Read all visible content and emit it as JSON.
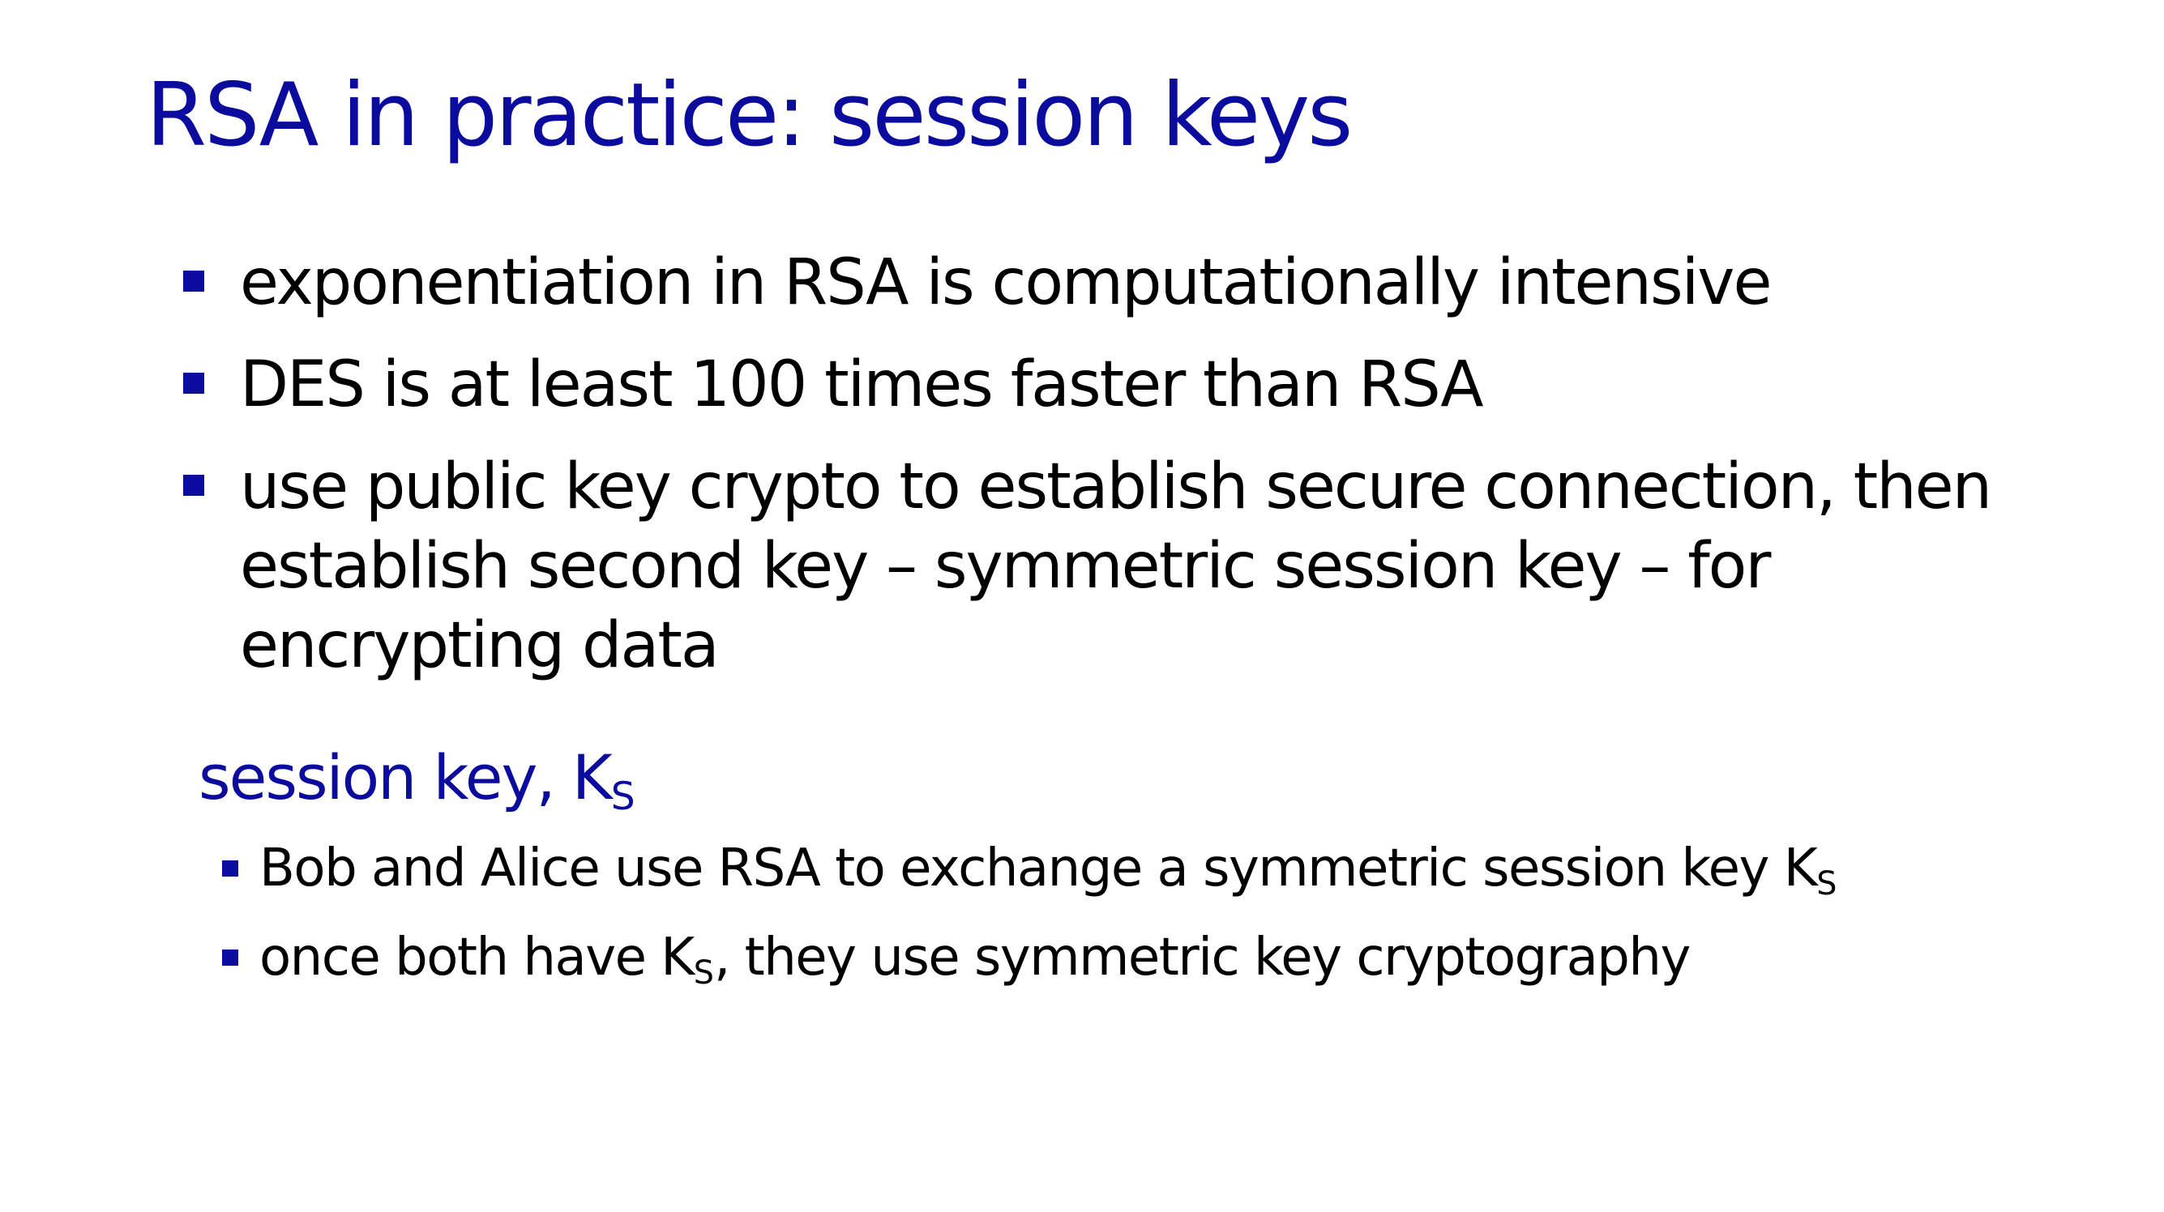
{
  "slide": {
    "title": "RSA in practice: session keys",
    "bullets": [
      "exponentiation in RSA is computationally intensive",
      "DES is at least 100 times faster than RSA",
      "use public key crypto to establish secure connection, then establish second key – symmetric session key – for encrypting data"
    ],
    "subheading": {
      "text": "session key, K",
      "subscript": "S"
    },
    "sub_bullets": [
      {
        "before": "Bob and Alice use RSA to exchange a symmetric session key K",
        "subscript": "S",
        "after": ""
      },
      {
        "before": "once both have K",
        "subscript": "S",
        "after": ", they use symmetric key cryptography"
      }
    ],
    "colors": {
      "accent": "#0b0b9e",
      "text": "#000000",
      "background": "#ffffff"
    },
    "icons": {
      "bullet": "square-bullet-icon"
    }
  }
}
